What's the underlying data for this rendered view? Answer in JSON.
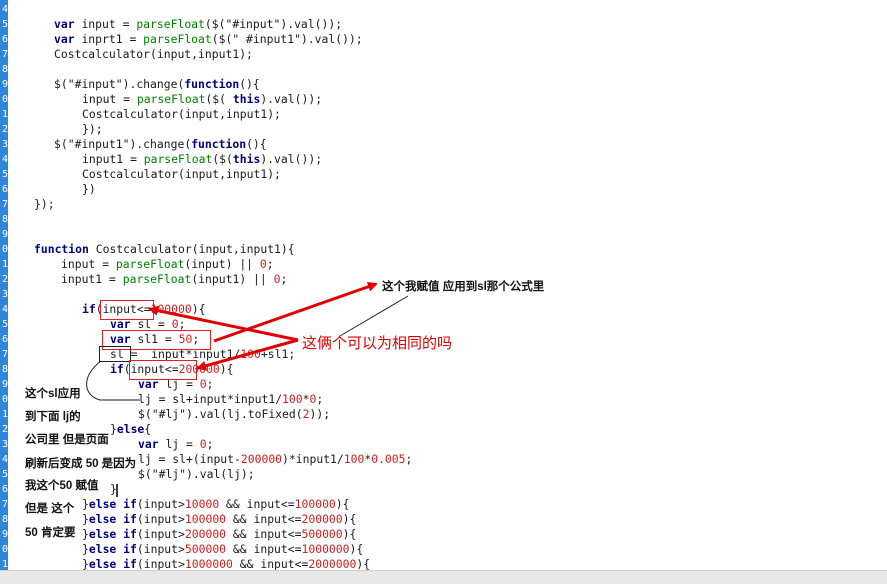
{
  "editor": {
    "line_numbers": [
      "4",
      "5",
      "6",
      "7",
      "8",
      "9",
      "0",
      "1",
      "2",
      "3",
      "4",
      "5",
      "6",
      "7",
      "8",
      "9",
      "0",
      "1",
      "2",
      "3",
      "4",
      "5",
      "6",
      "7",
      "8",
      "9",
      "0",
      "1",
      "2",
      "3",
      "4",
      "5",
      "6",
      "7",
      "8",
      "9",
      "0",
      "1",
      "2"
    ],
    "lines": [
      {
        "indent": 0,
        "text": ""
      },
      {
        "indent": 48,
        "text": "var input = parseFloat($(\"#input\").val());"
      },
      {
        "indent": 48,
        "text": "var inprt1 = parseFloat($(\" #input1\").val());"
      },
      {
        "indent": 48,
        "text": "Costcalculator(input,input1);"
      },
      {
        "indent": 48,
        "text": ""
      },
      {
        "indent": 48,
        "text": "$(\"#input\").change(function(){"
      },
      {
        "indent": 76,
        "text": "input = parseFloat($( this).val());"
      },
      {
        "indent": 76,
        "text": "Costcalculator(input,input1);"
      },
      {
        "indent": 76,
        "text": "});"
      },
      {
        "indent": 48,
        "text": "$(\"#input1\").change(function(){"
      },
      {
        "indent": 76,
        "text": "input1 = parseFloat($(this).val());"
      },
      {
        "indent": 76,
        "text": "Costcalculator(input,input1);"
      },
      {
        "indent": 76,
        "text": "})"
      },
      {
        "indent": 28,
        "text": "});"
      },
      {
        "indent": 28,
        "text": ""
      },
      {
        "indent": 28,
        "text": ""
      },
      {
        "indent": 28,
        "text": "function Costcalculator(input,input1){"
      },
      {
        "indent": 55,
        "text": "input = parseFloat(input) || 0;"
      },
      {
        "indent": 55,
        "text": "input1 = parseFloat(input1) || 0;"
      },
      {
        "indent": 55,
        "text": ""
      },
      {
        "indent": 76,
        "text": "if(input<=100000){"
      },
      {
        "indent": 104,
        "text": "var sl = 0;"
      },
      {
        "indent": 104,
        "text": "var sl1 = 50;"
      },
      {
        "indent": 104,
        "text": "sl =  input*input1/100+sl1;"
      },
      {
        "indent": 104,
        "text": "if(input<=200000){"
      },
      {
        "indent": 132,
        "text": "var lj = 0;"
      },
      {
        "indent": 132,
        "text": "lj = sl+input*input1/100*0;"
      },
      {
        "indent": 132,
        "text": "$(\"#lj\").val(lj.toFixed(2));"
      },
      {
        "indent": 104,
        "text": "}else{"
      },
      {
        "indent": 132,
        "text": "var lj = 0;"
      },
      {
        "indent": 132,
        "text": "lj = sl+(input-200000)*input1/100*0.005;"
      },
      {
        "indent": 132,
        "text": "$(\"#lj\").val(lj);"
      },
      {
        "indent": 104,
        "text": "}"
      },
      {
        "indent": 76,
        "text": "}else if(input>10000 && input<=100000){"
      },
      {
        "indent": 76,
        "text": "}else if(input>100000 && input<=200000){"
      },
      {
        "indent": 76,
        "text": "}else if(input>200000 && input<=500000){"
      },
      {
        "indent": 76,
        "text": "}else if(input>500000 && input<=1000000){"
      },
      {
        "indent": 76,
        "text": "}else if(input>1000000 && input<=2000000){"
      }
    ]
  },
  "annotations": {
    "top_right_note": "这个我赋值 应用到sl那个公式里",
    "middle_note": "这俩个可以为相同的吗",
    "left_note_lines": [
      "这个sl应用",
      "到下面 lj的",
      "公司里 但是页面",
      "刷新后变成 50 是因为",
      "我这个50 赋值",
      "",
      "但是 这个",
      "50 肯定要"
    ]
  },
  "colors": {
    "gutter": "#2f86d8",
    "keyword": "#000080",
    "function_call": "#008000",
    "number": "#cc2020",
    "annotation_red": "#e00000"
  }
}
